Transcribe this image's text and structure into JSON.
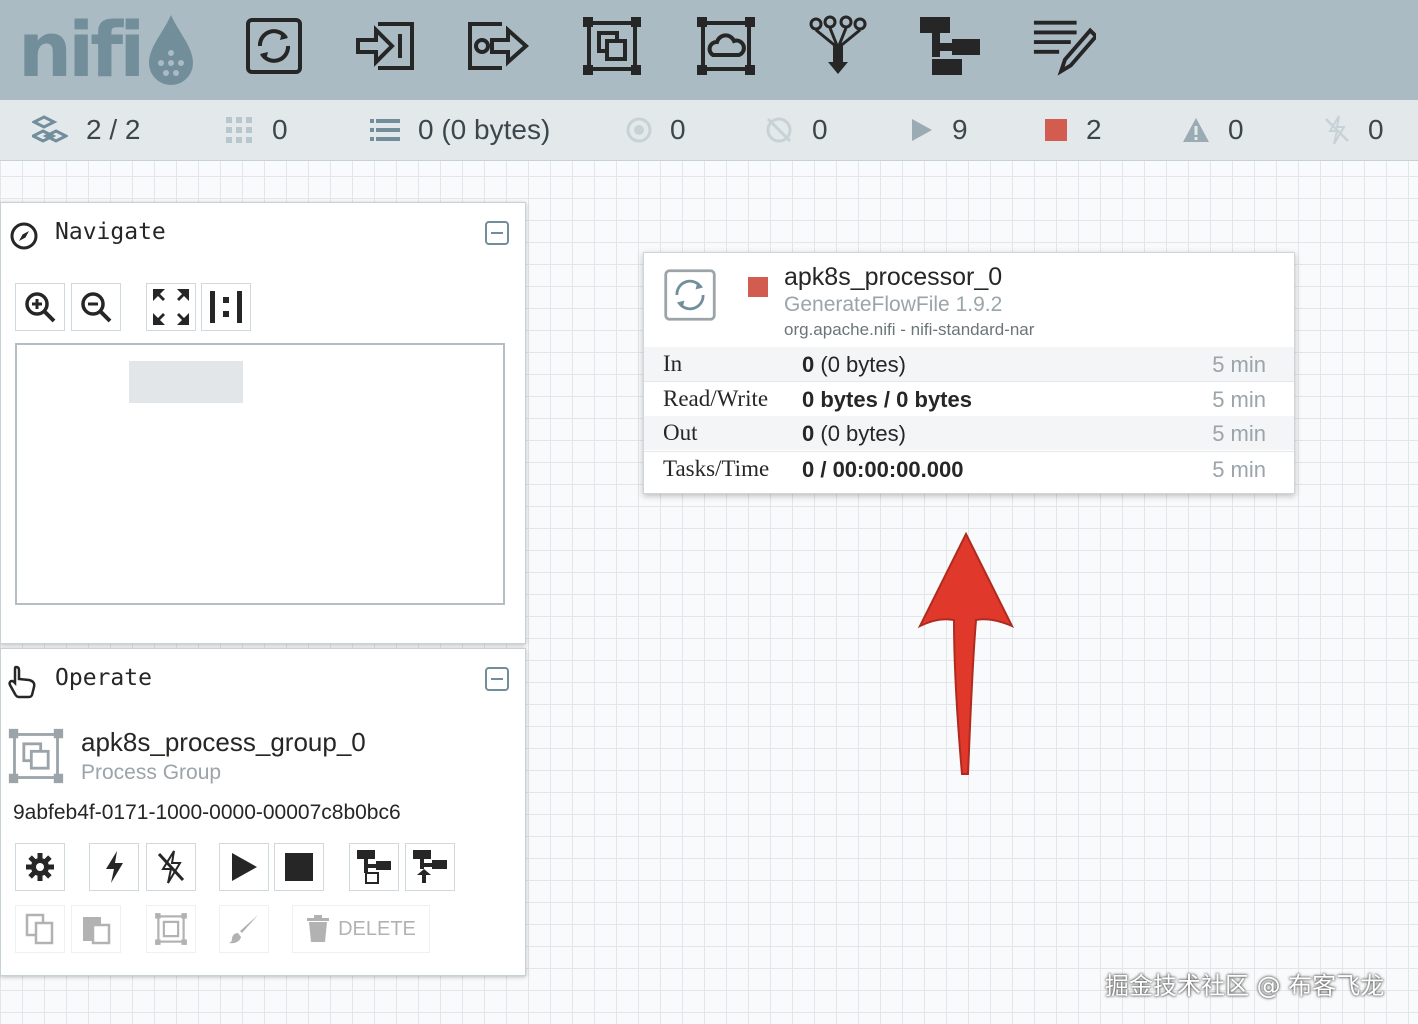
{
  "app": {
    "logo_text": "nifi",
    "brand_color": "#728e9b",
    "header_color": "#aabbc3"
  },
  "toolbar": {
    "icons": [
      "processor-icon",
      "input-port-icon",
      "output-port-icon",
      "process-group-icon",
      "remote-process-group-icon",
      "funnel-icon",
      "template-icon",
      "label-icon"
    ]
  },
  "status": {
    "threads": "2 / 2",
    "queued_count": "0",
    "queued": "0 (0 bytes)",
    "transmitting": "0",
    "not_transmitting": "0",
    "running": "9",
    "stopped": "2",
    "invalid": "0",
    "disabled": "0"
  },
  "navigate": {
    "title": "Navigate"
  },
  "operate": {
    "title": "Operate",
    "name": "apk8s_process_group_0",
    "type": "Process Group",
    "id": "9abfeb4f-0171-1000-0000-00007c8b0bc6",
    "delete_label": "DELETE"
  },
  "processor": {
    "name": "apk8s_processor_0",
    "type": "GenerateFlowFile 1.9.2",
    "bundle": "org.apache.nifi - nifi-standard-nar",
    "state_color": "#ba554a",
    "stats": [
      {
        "label": "In",
        "value_bold": "0",
        "value_rest": " (0 bytes)",
        "time": "5 min"
      },
      {
        "label": "Read/Write",
        "value_bold": "0 bytes / 0 bytes",
        "value_rest": "",
        "time": "5 min"
      },
      {
        "label": "Out",
        "value_bold": "0",
        "value_rest": " (0 bytes)",
        "time": "5 min"
      },
      {
        "label": "Tasks/Time",
        "value_bold": "0 / 00:00:00.000",
        "value_rest": "",
        "time": "5 min"
      }
    ]
  },
  "annotation": {
    "arrow_color": "#e0392b"
  },
  "watermark": "掘金技术社区 @ 布客飞龙"
}
